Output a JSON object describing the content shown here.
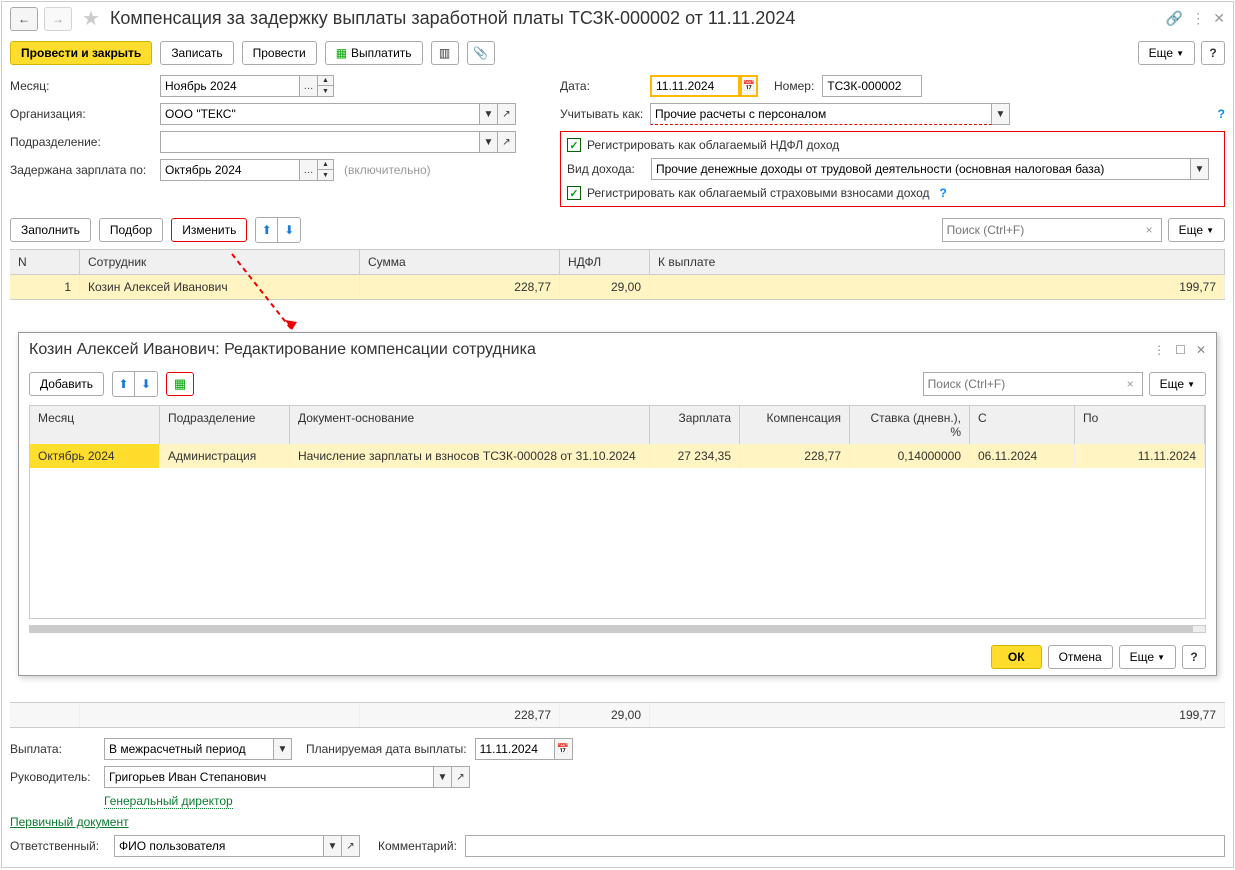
{
  "title": "Компенсация за задержку выплаты заработной платы ТСЗК-000002 от 11.11.2024",
  "toolbar": {
    "post_close": "Провести и закрыть",
    "save": "Записать",
    "post": "Провести",
    "pay": "Выплатить",
    "more": "Еще"
  },
  "labels": {
    "month": "Месяц:",
    "org": "Организация:",
    "dept": "Подразделение:",
    "delayed_until": "Задержана зарплата по:",
    "date": "Дата:",
    "number": "Номер:",
    "account_as": "Учитывать как:",
    "reg_ndfl": "Регистрировать как облагаемый НДФЛ доход",
    "income_type": "Вид дохода:",
    "reg_insurance": "Регистрировать как облагаемый страховыми взносами доход",
    "inclusive": "(включительно)",
    "payment": "Выплата:",
    "planned_date": "Планируемая дата выплаты:",
    "manager": "Руководитель:",
    "manager_pos": "Генеральный директор",
    "primary_doc": "Первичный документ",
    "responsible": "Ответственный:",
    "comment": "Комментарий:"
  },
  "values": {
    "month": "Ноябрь 2024",
    "org": "ООО \"ТЕКС\"",
    "dept": "",
    "delayed_until": "Октябрь 2024",
    "date": "11.11.2024",
    "number": "ТСЗК-000002",
    "account_as": "Прочие расчеты с персоналом",
    "income_type": "Прочие денежные доходы от трудовой деятельности (основная налоговая база)",
    "payment": "В межрасчетный период",
    "planned_date": "11.11.2024",
    "manager": "Григорьев Иван Степанович",
    "responsible": "ФИО пользователя",
    "comment": ""
  },
  "tbl_toolbar": {
    "fill": "Заполнить",
    "pick": "Подбор",
    "change": "Изменить",
    "search_ph": "Поиск (Ctrl+F)",
    "more": "Еще"
  },
  "table": {
    "headers": {
      "n": "N",
      "emp": "Сотрудник",
      "sum": "Сумма",
      "ndfl": "НДФЛ",
      "payout": "К выплате"
    },
    "rows": [
      {
        "n": "1",
        "emp": "Козин Алексей Иванович",
        "sum": "228,77",
        "ndfl": "29,00",
        "payout": "199,77"
      }
    ],
    "totals": {
      "sum": "228,77",
      "ndfl": "29,00",
      "payout": "199,77"
    }
  },
  "popup": {
    "title": "Козин Алексей Иванович: Редактирование компенсации сотрудника",
    "add": "Добавить",
    "more": "Еще",
    "search_ph": "Поиск (Ctrl+F)",
    "ok": "ОК",
    "cancel": "Отмена",
    "headers": {
      "month": "Месяц",
      "dept": "Подразделение",
      "doc": "Документ-основание",
      "salary": "Зарплата",
      "comp": "Компенсация",
      "rate": "Ставка (дневн.), %",
      "from": "С",
      "to": "По"
    },
    "rows": [
      {
        "month": "Октябрь 2024",
        "dept": "Администрация",
        "doc": "Начисление зарплаты и взносов ТСЗК-000028 от 31.10.2024",
        "salary": "27 234,35",
        "comp": "228,77",
        "rate": "0,14000000",
        "from": "06.11.2024",
        "to": "11.11.2024"
      }
    ]
  }
}
